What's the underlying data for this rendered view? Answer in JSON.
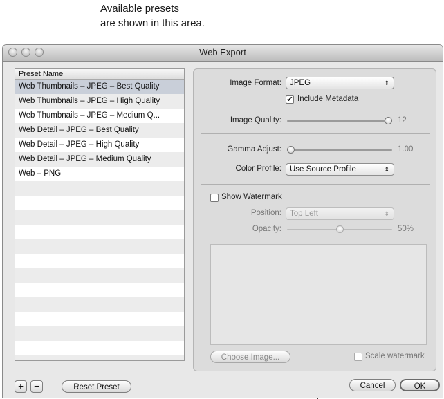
{
  "callout": {
    "line1": "Available presets",
    "line2": "are shown in this area."
  },
  "window": {
    "title": "Web Export"
  },
  "preset_list": {
    "header": "Preset Name",
    "items": [
      {
        "label": "Web Thumbnails – JPEG – Best Quality",
        "selected": true
      },
      {
        "label": "Web Thumbnails – JPEG – High Quality"
      },
      {
        "label": "Web Thumbnails – JPEG – Medium Q..."
      },
      {
        "label": "Web Detail – JPEG – Best Quality"
      },
      {
        "label": "Web Detail – JPEG – High Quality"
      },
      {
        "label": "Web Detail – JPEG – Medium Quality"
      },
      {
        "label": "Web – PNG"
      }
    ]
  },
  "bottom_bar": {
    "add_label": "+",
    "remove_label": "−",
    "reset_label": "Reset Preset",
    "cancel_label": "Cancel",
    "ok_label": "OK"
  },
  "settings": {
    "image_format_label": "Image Format:",
    "image_format_value": "JPEG",
    "include_metadata_label": "Include Metadata",
    "include_metadata_checked": true,
    "image_quality_label": "Image Quality:",
    "image_quality_value": "12",
    "image_quality_fraction": 1.0,
    "gamma_label": "Gamma Adjust:",
    "gamma_value": "1.00",
    "gamma_fraction": 0.0,
    "color_profile_label": "Color Profile:",
    "color_profile_value": "Use Source Profile"
  },
  "watermark": {
    "show_label": "Show Watermark",
    "show_checked": false,
    "position_label": "Position:",
    "position_value": "Top Left",
    "opacity_label": "Opacity:",
    "opacity_value": "50%",
    "opacity_fraction": 0.5,
    "choose_image_label": "Choose Image...",
    "scale_label": "Scale watermark",
    "scale_checked": false
  },
  "icons": {
    "popup_arrows": "⇕",
    "checkmark": "✔"
  }
}
